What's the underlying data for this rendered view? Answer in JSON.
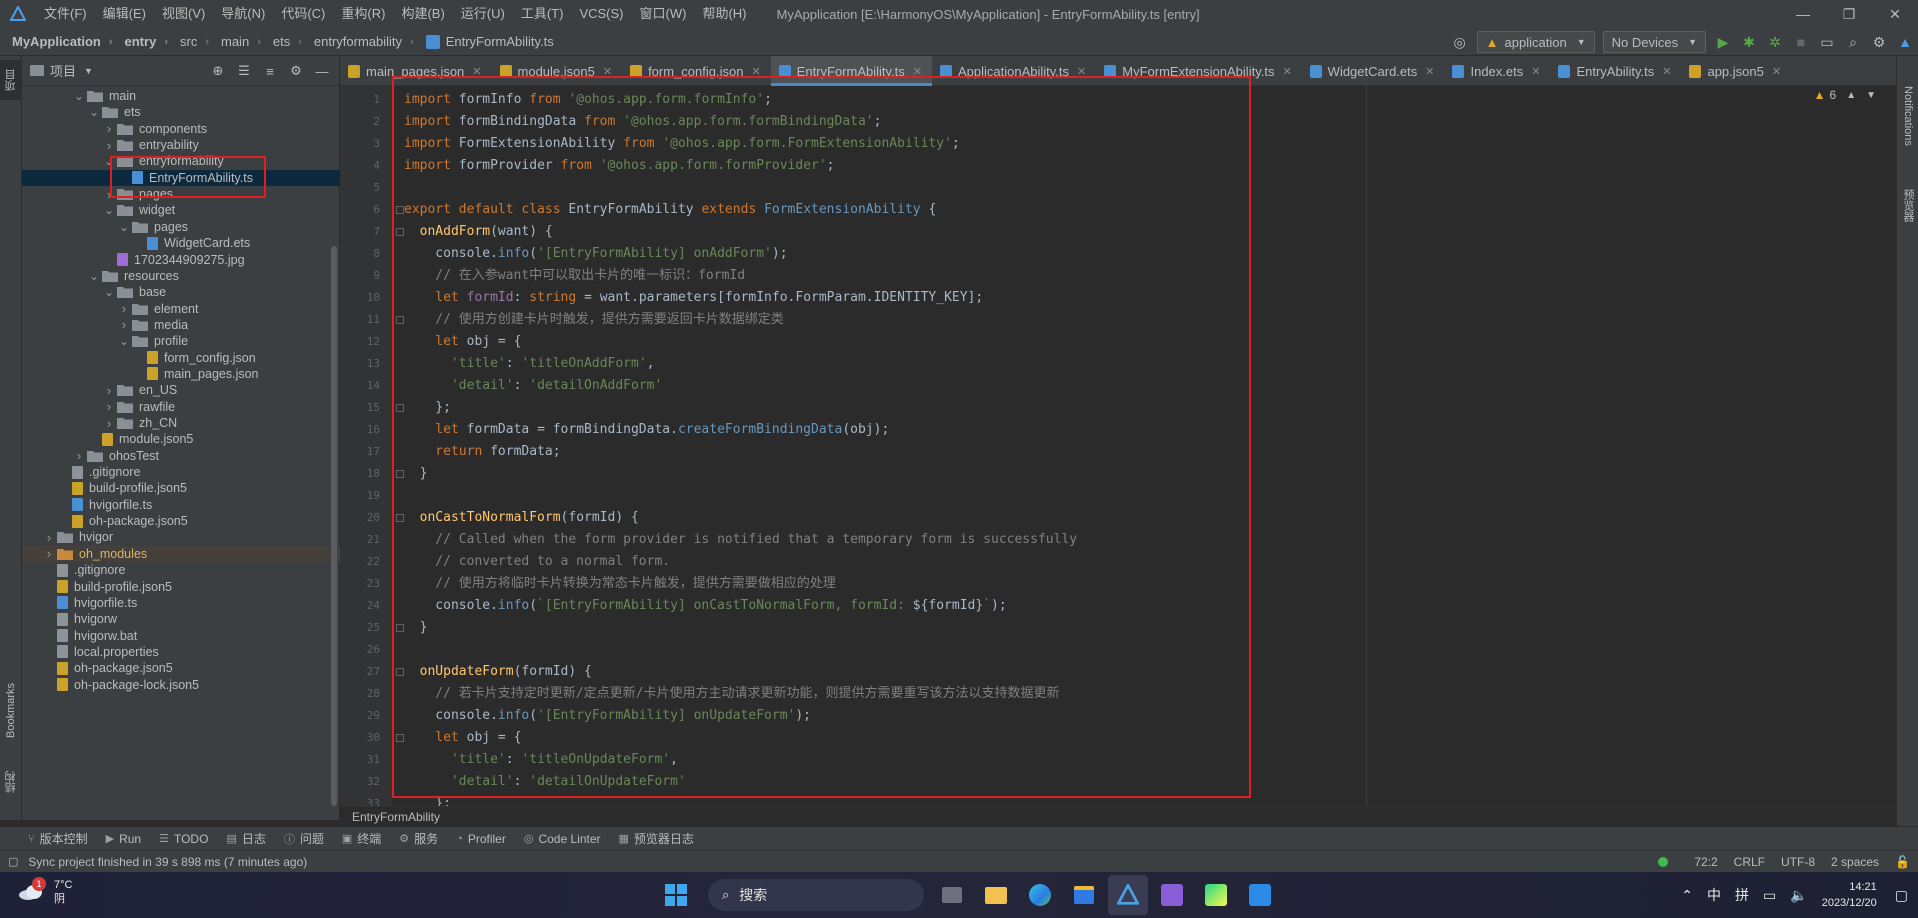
{
  "titlebar": {
    "menu": [
      "文件(F)",
      "编辑(E)",
      "视图(V)",
      "导航(N)",
      "代码(C)",
      "重构(R)",
      "构建(B)",
      "运行(U)",
      "工具(T)",
      "VCS(S)",
      "窗口(W)",
      "帮助(H)"
    ],
    "window_title": "MyApplication [E:\\HarmonyOS\\MyApplication] - EntryFormAbility.ts [entry]"
  },
  "navbar": {
    "crumbs": [
      "MyApplication",
      "entry",
      "src",
      "main",
      "ets",
      "entryformability",
      "EntryFormAbility.ts"
    ],
    "run_config": "application",
    "device": "No Devices"
  },
  "left_strip": {
    "project": "项目",
    "bookmarks": "Bookmarks",
    "structure": "结构"
  },
  "project_panel": {
    "title": "项目",
    "tree": [
      {
        "name": "main",
        "depth": 3,
        "kind": "folder",
        "open": true
      },
      {
        "name": "ets",
        "depth": 4,
        "kind": "folder",
        "open": true
      },
      {
        "name": "components",
        "depth": 5,
        "kind": "folder",
        "open": false
      },
      {
        "name": "entryability",
        "depth": 5,
        "kind": "folder",
        "open": false
      },
      {
        "name": "entryformability",
        "depth": 5,
        "kind": "folder",
        "open": true
      },
      {
        "name": "EntryFormAbility.ts",
        "depth": 6,
        "kind": "ts",
        "selected": true
      },
      {
        "name": "pages",
        "depth": 5,
        "kind": "folder",
        "open": false
      },
      {
        "name": "widget",
        "depth": 5,
        "kind": "folder",
        "open": true
      },
      {
        "name": "pages",
        "depth": 6,
        "kind": "folder",
        "open": true
      },
      {
        "name": "WidgetCard.ets",
        "depth": 7,
        "kind": "ets"
      },
      {
        "name": "1702344909275.jpg",
        "depth": 5,
        "kind": "img"
      },
      {
        "name": "resources",
        "depth": 4,
        "kind": "folder",
        "open": true
      },
      {
        "name": "base",
        "depth": 5,
        "kind": "folder",
        "open": true
      },
      {
        "name": "element",
        "depth": 6,
        "kind": "folder",
        "open": false
      },
      {
        "name": "media",
        "depth": 6,
        "kind": "folder",
        "open": false
      },
      {
        "name": "profile",
        "depth": 6,
        "kind": "folder",
        "open": true
      },
      {
        "name": "form_config.json",
        "depth": 7,
        "kind": "json"
      },
      {
        "name": "main_pages.json",
        "depth": 7,
        "kind": "json"
      },
      {
        "name": "en_US",
        "depth": 5,
        "kind": "folder",
        "open": false
      },
      {
        "name": "rawfile",
        "depth": 5,
        "kind": "folder",
        "open": false
      },
      {
        "name": "zh_CN",
        "depth": 5,
        "kind": "folder",
        "open": false
      },
      {
        "name": "module.json5",
        "depth": 4,
        "kind": "json"
      },
      {
        "name": "ohosTest",
        "depth": 3,
        "kind": "folder",
        "open": false
      },
      {
        "name": ".gitignore",
        "depth": 2,
        "kind": "txt"
      },
      {
        "name": "build-profile.json5",
        "depth": 2,
        "kind": "json"
      },
      {
        "name": "hvigorfile.ts",
        "depth": 2,
        "kind": "ts"
      },
      {
        "name": "oh-package.json5",
        "depth": 2,
        "kind": "json"
      },
      {
        "name": "hvigor",
        "depth": 1,
        "kind": "folder",
        "open": false
      },
      {
        "name": "oh_modules",
        "depth": 1,
        "kind": "folder-orange",
        "open": false,
        "highlight": true
      },
      {
        "name": ".gitignore",
        "depth": 1,
        "kind": "txt"
      },
      {
        "name": "build-profile.json5",
        "depth": 1,
        "kind": "json"
      },
      {
        "name": "hvigorfile.ts",
        "depth": 1,
        "kind": "ts"
      },
      {
        "name": "hvigorw",
        "depth": 1,
        "kind": "txt"
      },
      {
        "name": "hvigorw.bat",
        "depth": 1,
        "kind": "txt"
      },
      {
        "name": "local.properties",
        "depth": 1,
        "kind": "txt"
      },
      {
        "name": "oh-package.json5",
        "depth": 1,
        "kind": "json"
      },
      {
        "name": "oh-package-lock.json5",
        "depth": 1,
        "kind": "json"
      }
    ]
  },
  "tabs": [
    {
      "label": "main_pages.json",
      "color": "#c9a227"
    },
    {
      "label": "module.json5",
      "color": "#c9a227"
    },
    {
      "label": "form_config.json",
      "color": "#c9a227"
    },
    {
      "label": "EntryFormAbility.ts",
      "color": "#4a8fd4",
      "active": true
    },
    {
      "label": "ApplicationAbility.ts",
      "color": "#4a8fd4"
    },
    {
      "label": "MyFormExtensionAbility.ts",
      "color": "#4a8fd4"
    },
    {
      "label": "WidgetCard.ets",
      "color": "#4a8fd4"
    },
    {
      "label": "Index.ets",
      "color": "#4a8fd4"
    },
    {
      "label": "EntryAbility.ts",
      "color": "#4a8fd4"
    },
    {
      "label": "app.json5",
      "color": "#c9a227"
    }
  ],
  "editor": {
    "warnings": "6",
    "lines": [
      [
        [
          "kw",
          "import "
        ],
        [
          "",
          "formInfo "
        ],
        [
          "kw",
          "from "
        ],
        [
          "str",
          "'@ohos.app.form.formInfo'"
        ],
        [
          "",
          ";"
        ]
      ],
      [
        [
          "kw",
          "import "
        ],
        [
          "",
          "formBindingData "
        ],
        [
          "kw",
          "from "
        ],
        [
          "str",
          "'@ohos.app.form.formBindingData'"
        ],
        [
          "",
          ";"
        ]
      ],
      [
        [
          "kw",
          "import "
        ],
        [
          "",
          "FormExtensionAbility "
        ],
        [
          "kw",
          "from "
        ],
        [
          "str",
          "'@ohos.app.form.FormExtensionAbility'"
        ],
        [
          "",
          ";"
        ]
      ],
      [
        [
          "kw",
          "import "
        ],
        [
          "",
          "formProvider "
        ],
        [
          "kw",
          "from "
        ],
        [
          "str",
          "'@ohos.app.form.formProvider'"
        ],
        [
          "",
          ";"
        ]
      ],
      [],
      [
        [
          "kw",
          "export default class "
        ],
        [
          "",
          "EntryFormAbility "
        ],
        [
          "kw",
          "extends "
        ],
        [
          "type",
          "FormExtensionAbility "
        ],
        [
          "",
          "{"
        ]
      ],
      [
        [
          "",
          "  "
        ],
        [
          "fn",
          "onAddForm"
        ],
        [
          "",
          "(want) {"
        ]
      ],
      [
        [
          "",
          "    console."
        ],
        [
          "type",
          "info"
        ],
        [
          "",
          "("
        ],
        [
          "str",
          "'[EntryFormAbility] onAddForm'"
        ],
        [
          "",
          ");"
        ]
      ],
      [
        [
          "cm",
          "    // 在入参want中可以取出卡片的唯一标识：formId"
        ]
      ],
      [
        [
          "kw",
          "    let "
        ],
        [
          "prop",
          "formId"
        ],
        [
          "",
          ": "
        ],
        [
          "kw",
          "string "
        ],
        [
          "",
          "= want.parameters[formInfo.FormParam.IDENTITY_KEY];"
        ]
      ],
      [
        [
          "cm",
          "    // 使用方创建卡片时触发，提供方需要返回卡片数据绑定类"
        ]
      ],
      [
        [
          "kw",
          "    let "
        ],
        [
          "",
          "obj = {"
        ]
      ],
      [
        [
          "",
          "      "
        ],
        [
          "str",
          "'title'"
        ],
        [
          "",
          ": "
        ],
        [
          "str",
          "'titleOnAddForm'"
        ],
        [
          "",
          ","
        ]
      ],
      [
        [
          "",
          "      "
        ],
        [
          "str",
          "'detail'"
        ],
        [
          "",
          ": "
        ],
        [
          "str",
          "'detailOnAddForm'"
        ]
      ],
      [
        [
          "",
          "    };"
        ]
      ],
      [
        [
          "kw",
          "    let "
        ],
        [
          "",
          "formData = formBindingData."
        ],
        [
          "type",
          "createFormBindingData"
        ],
        [
          "",
          "(obj);"
        ]
      ],
      [
        [
          "kw",
          "    return "
        ],
        [
          "",
          "formData;"
        ]
      ],
      [
        [
          "",
          "  }"
        ]
      ],
      [],
      [
        [
          "",
          "  "
        ],
        [
          "fn",
          "onCastToNormalForm"
        ],
        [
          "",
          "(formId) {"
        ]
      ],
      [
        [
          "cm",
          "    // Called when the form provider is notified that a temporary form is successfully"
        ]
      ],
      [
        [
          "cm",
          "    // converted to a normal form."
        ]
      ],
      [
        [
          "cm",
          "    // 使用方将临时卡片转换为常态卡片触发，提供方需要做相应的处理"
        ]
      ],
      [
        [
          "",
          "    console."
        ],
        [
          "type",
          "info"
        ],
        [
          "",
          "("
        ],
        [
          "str",
          "`[EntryFormAbility] onCastToNormalForm, formId: "
        ],
        [
          "",
          "${formId}"
        ],
        [
          "str",
          "`"
        ],
        [
          "",
          ");"
        ]
      ],
      [
        [
          "",
          "  }"
        ]
      ],
      [],
      [
        [
          "",
          "  "
        ],
        [
          "fn",
          "onUpdateForm"
        ],
        [
          "",
          "(formId) {"
        ]
      ],
      [
        [
          "cm",
          "    // 若卡片支持定时更新/定点更新/卡片使用方主动请求更新功能，则提供方需要重写该方法以支持数据更新"
        ]
      ],
      [
        [
          "",
          "    console."
        ],
        [
          "type",
          "info"
        ],
        [
          "",
          "("
        ],
        [
          "str",
          "'[EntryFormAbility] onUpdateForm'"
        ],
        [
          "",
          ");"
        ]
      ],
      [
        [
          "kw",
          "    let "
        ],
        [
          "",
          "obj = {"
        ]
      ],
      [
        [
          "",
          "      "
        ],
        [
          "str",
          "'title'"
        ],
        [
          "",
          ": "
        ],
        [
          "str",
          "'titleOnUpdateForm'"
        ],
        [
          "",
          ","
        ]
      ],
      [
        [
          "",
          "      "
        ],
        [
          "str",
          "'detail'"
        ],
        [
          "",
          ": "
        ],
        [
          "str",
          "'detailOnUpdateForm'"
        ]
      ],
      [
        [
          "",
          "    };"
        ]
      ]
    ]
  },
  "editor_breadcrumb": "EntryFormAbility",
  "right_strip": {
    "notifications": "Notifications",
    "previewer": "预览器"
  },
  "tool_windows": [
    "版本控制",
    "Run",
    "TODO",
    "日志",
    "问题",
    "终端",
    "服务",
    "Profiler",
    "Code Linter",
    "预览器日志"
  ],
  "status": {
    "message": "Sync project finished in 39 s 898 ms (7 minutes ago)",
    "position": "72:2",
    "line_sep": "CRLF",
    "encoding": "UTF-8",
    "indent": "2 spaces"
  },
  "taskbar": {
    "temp": "7°C",
    "weather": "阴",
    "weather_badge": "1",
    "search": "搜索",
    "ime1": "中",
    "ime2": "拼",
    "time": "14:21",
    "date": "2023/12/20"
  }
}
